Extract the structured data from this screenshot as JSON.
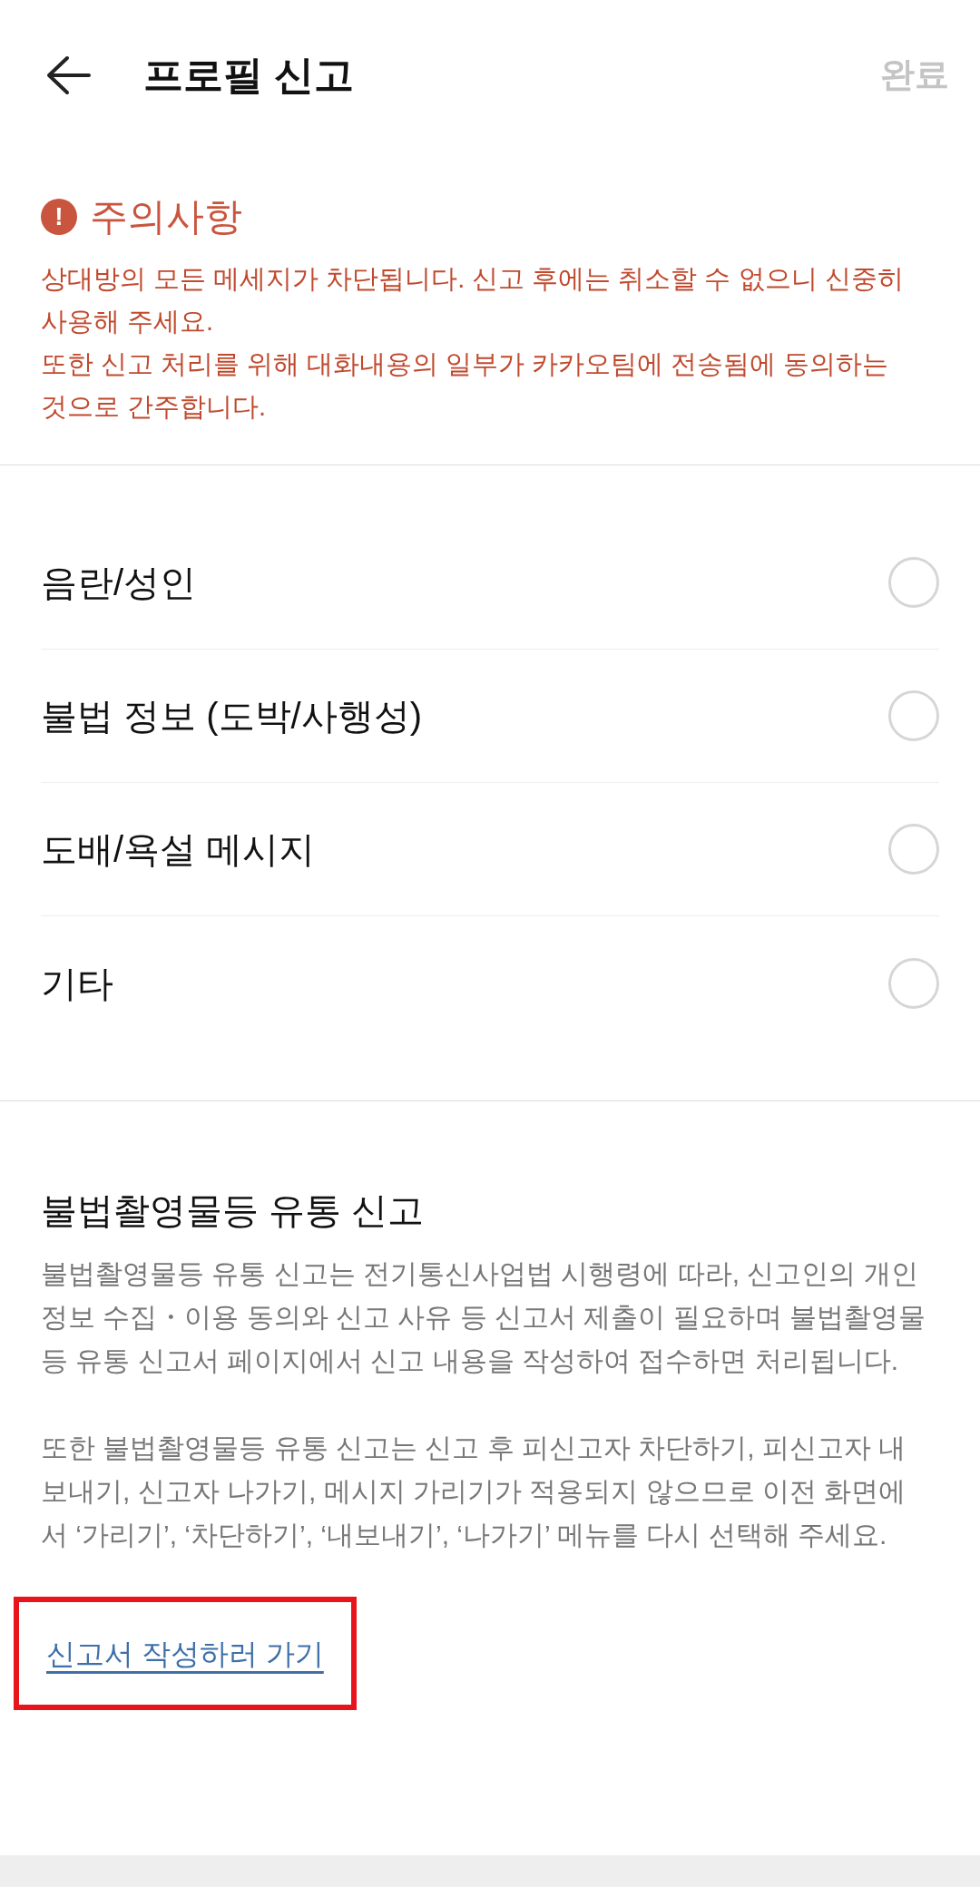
{
  "header": {
    "title": "프로필 신고",
    "action": "완료"
  },
  "notice": {
    "icon": "!",
    "title": "주의사항",
    "lines": [
      "상대방의 모든 메세지가 차단됩니다. 신고 후에는 취소할 수 없으니 신중히 사용해 주세요.",
      "또한 신고 처리를 위해 대화내용의 일부가 카카오팀에 전송됨에 동의하는 것으로 간주합니다."
    ]
  },
  "options": [
    {
      "label": "음란/성인",
      "selected": false
    },
    {
      "label": "불법 정보 (도박/사행성)",
      "selected": false
    },
    {
      "label": "도배/욕설 메시지",
      "selected": false
    },
    {
      "label": "기타",
      "selected": false
    }
  ],
  "illegal_section": {
    "title": "불법촬영물등 유통 신고",
    "paragraphs": [
      "불법촬영물등 유통 신고는 전기통신사업법 시행령에 따라, 신고인의 개인정보 수집・이용 동의와 신고 사유 등 신고서 제출이 필요하며 불법촬영물 등 유통 신고서 페이지에서 신고 내용을 작성하여 접수하면 처리됩니다.",
      "또한 불법촬영물등 유통 신고는 신고 후 피신고자 차단하기, 피신고자 내보내기, 신고자 나가기, 메시지 가리기가 적용되지 않으므로 이전 화면에서  ‘가리기’, ‘차단하기’, ‘내보내기’, ‘나가기’ 메뉴를 다시 선택해 주세요."
    ],
    "link": {
      "text": "신고서 작성하러 가기",
      "highlighted": true
    }
  }
}
